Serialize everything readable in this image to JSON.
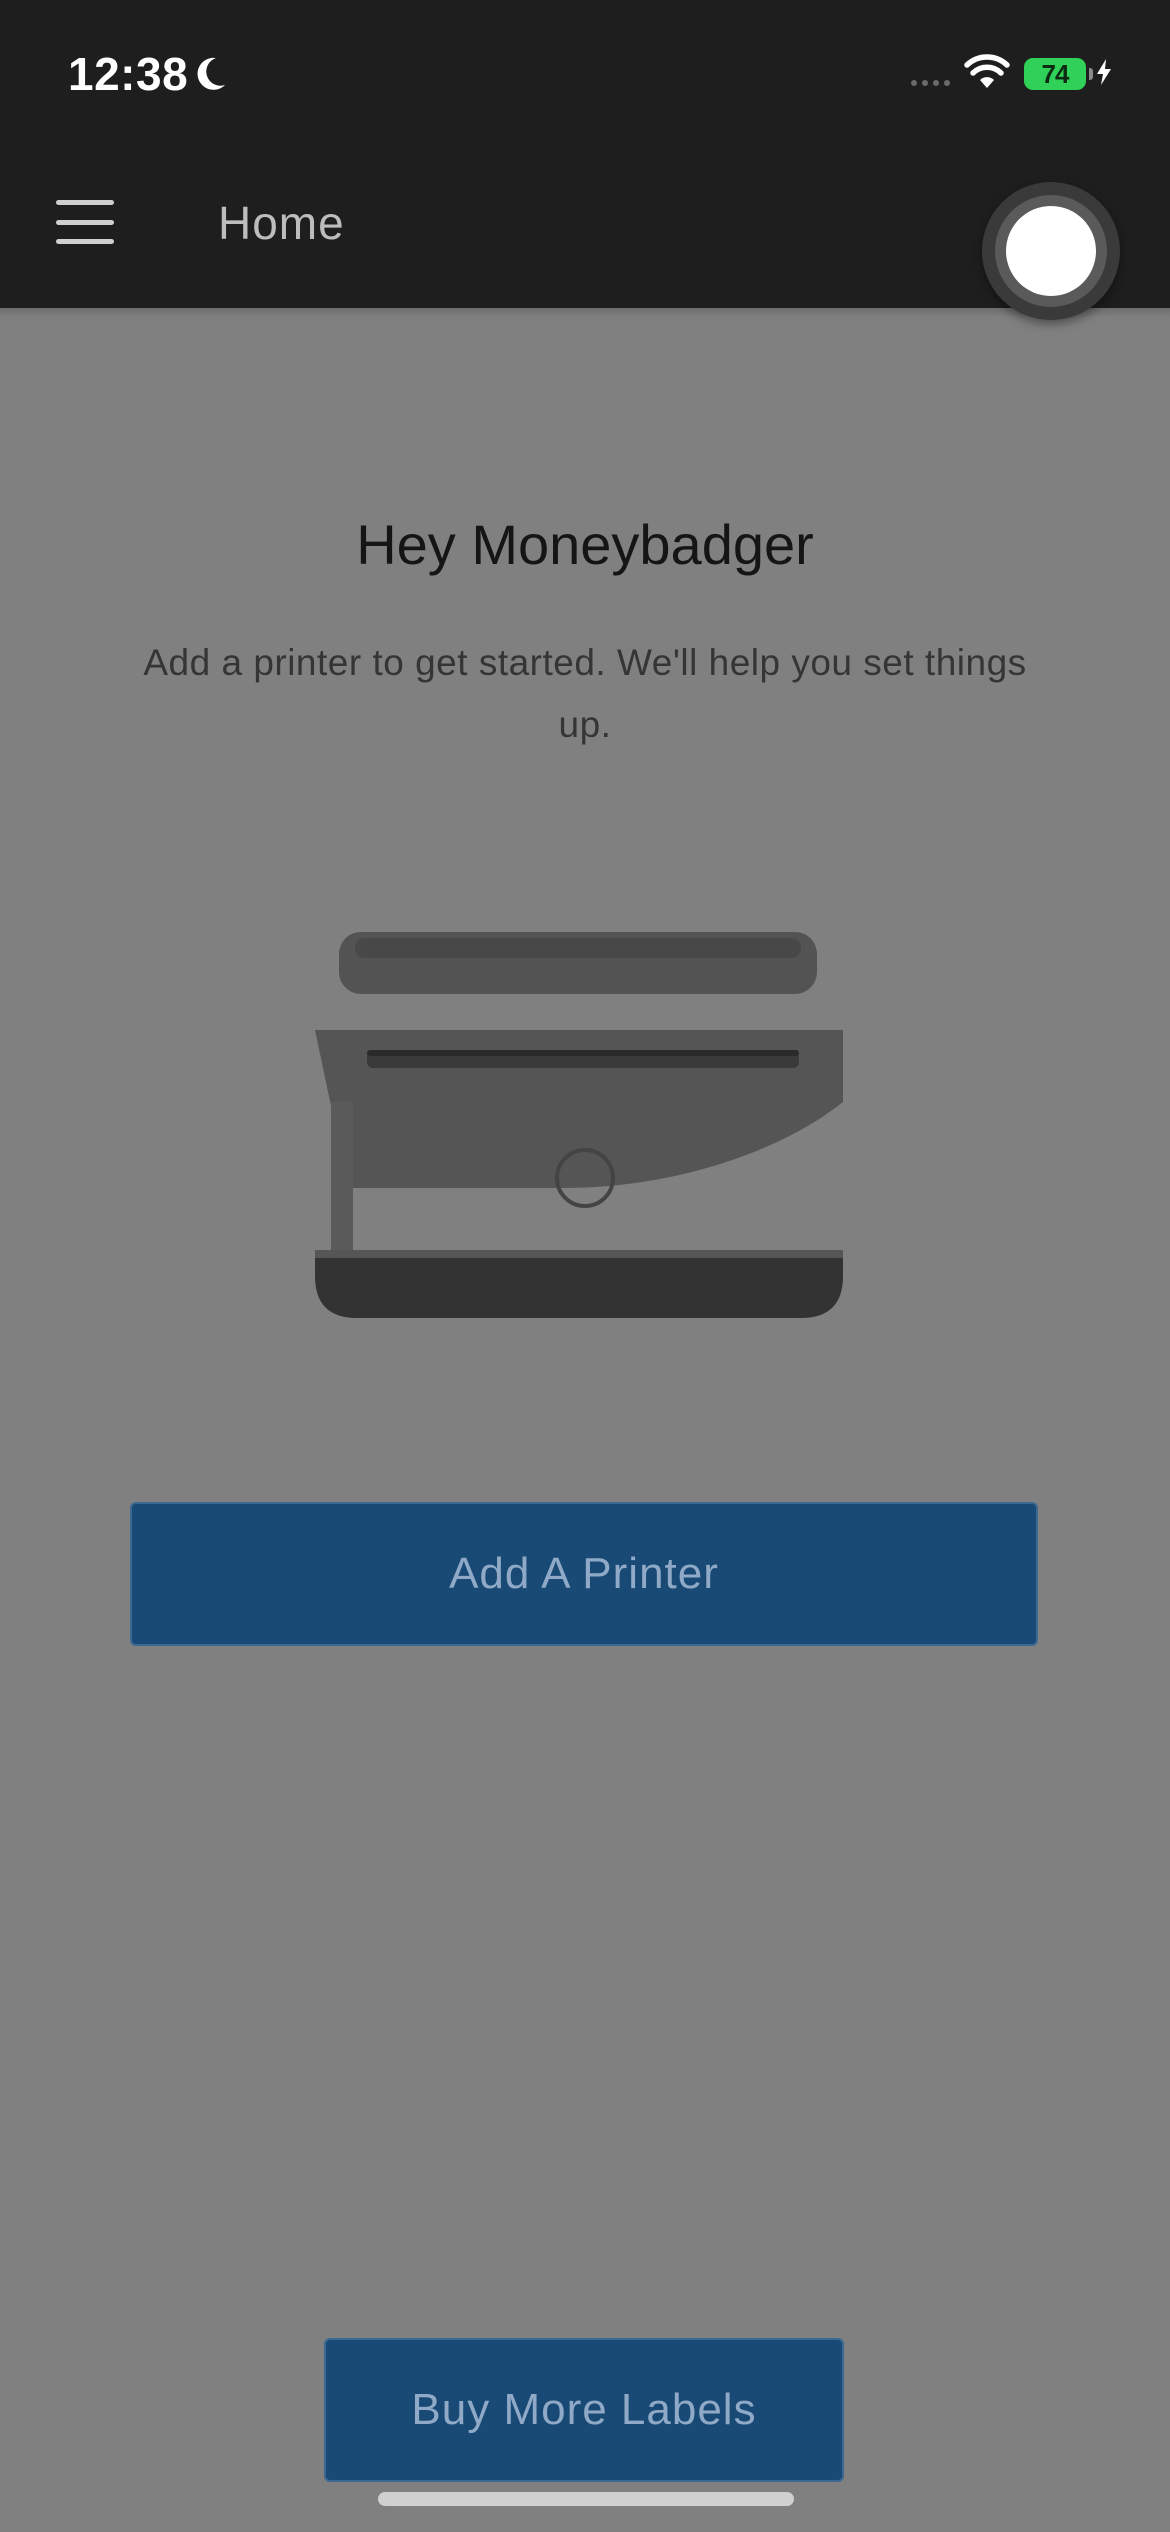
{
  "status_bar": {
    "time": "12:38",
    "battery_level": "74",
    "icons": [
      "moon-icon",
      "signal-icon",
      "wifi-icon",
      "battery-icon",
      "charging-bolt-icon"
    ]
  },
  "header": {
    "title": "Home",
    "menu_icon": "hamburger-menu-icon"
  },
  "main": {
    "greeting": "Hey Moneybadger",
    "subtitle": "Add a printer to get started. We'll help you set things up.",
    "illustration": "printer-illustration",
    "add_printer_label": "Add A Printer"
  },
  "footer": {
    "buy_labels_label": "Buy More Labels"
  },
  "colors": {
    "top_bar": "#1e1e1e",
    "background": "#808080",
    "button_fill": "#194a76",
    "button_text": "#8fa9c6",
    "battery": "#2fd158"
  }
}
